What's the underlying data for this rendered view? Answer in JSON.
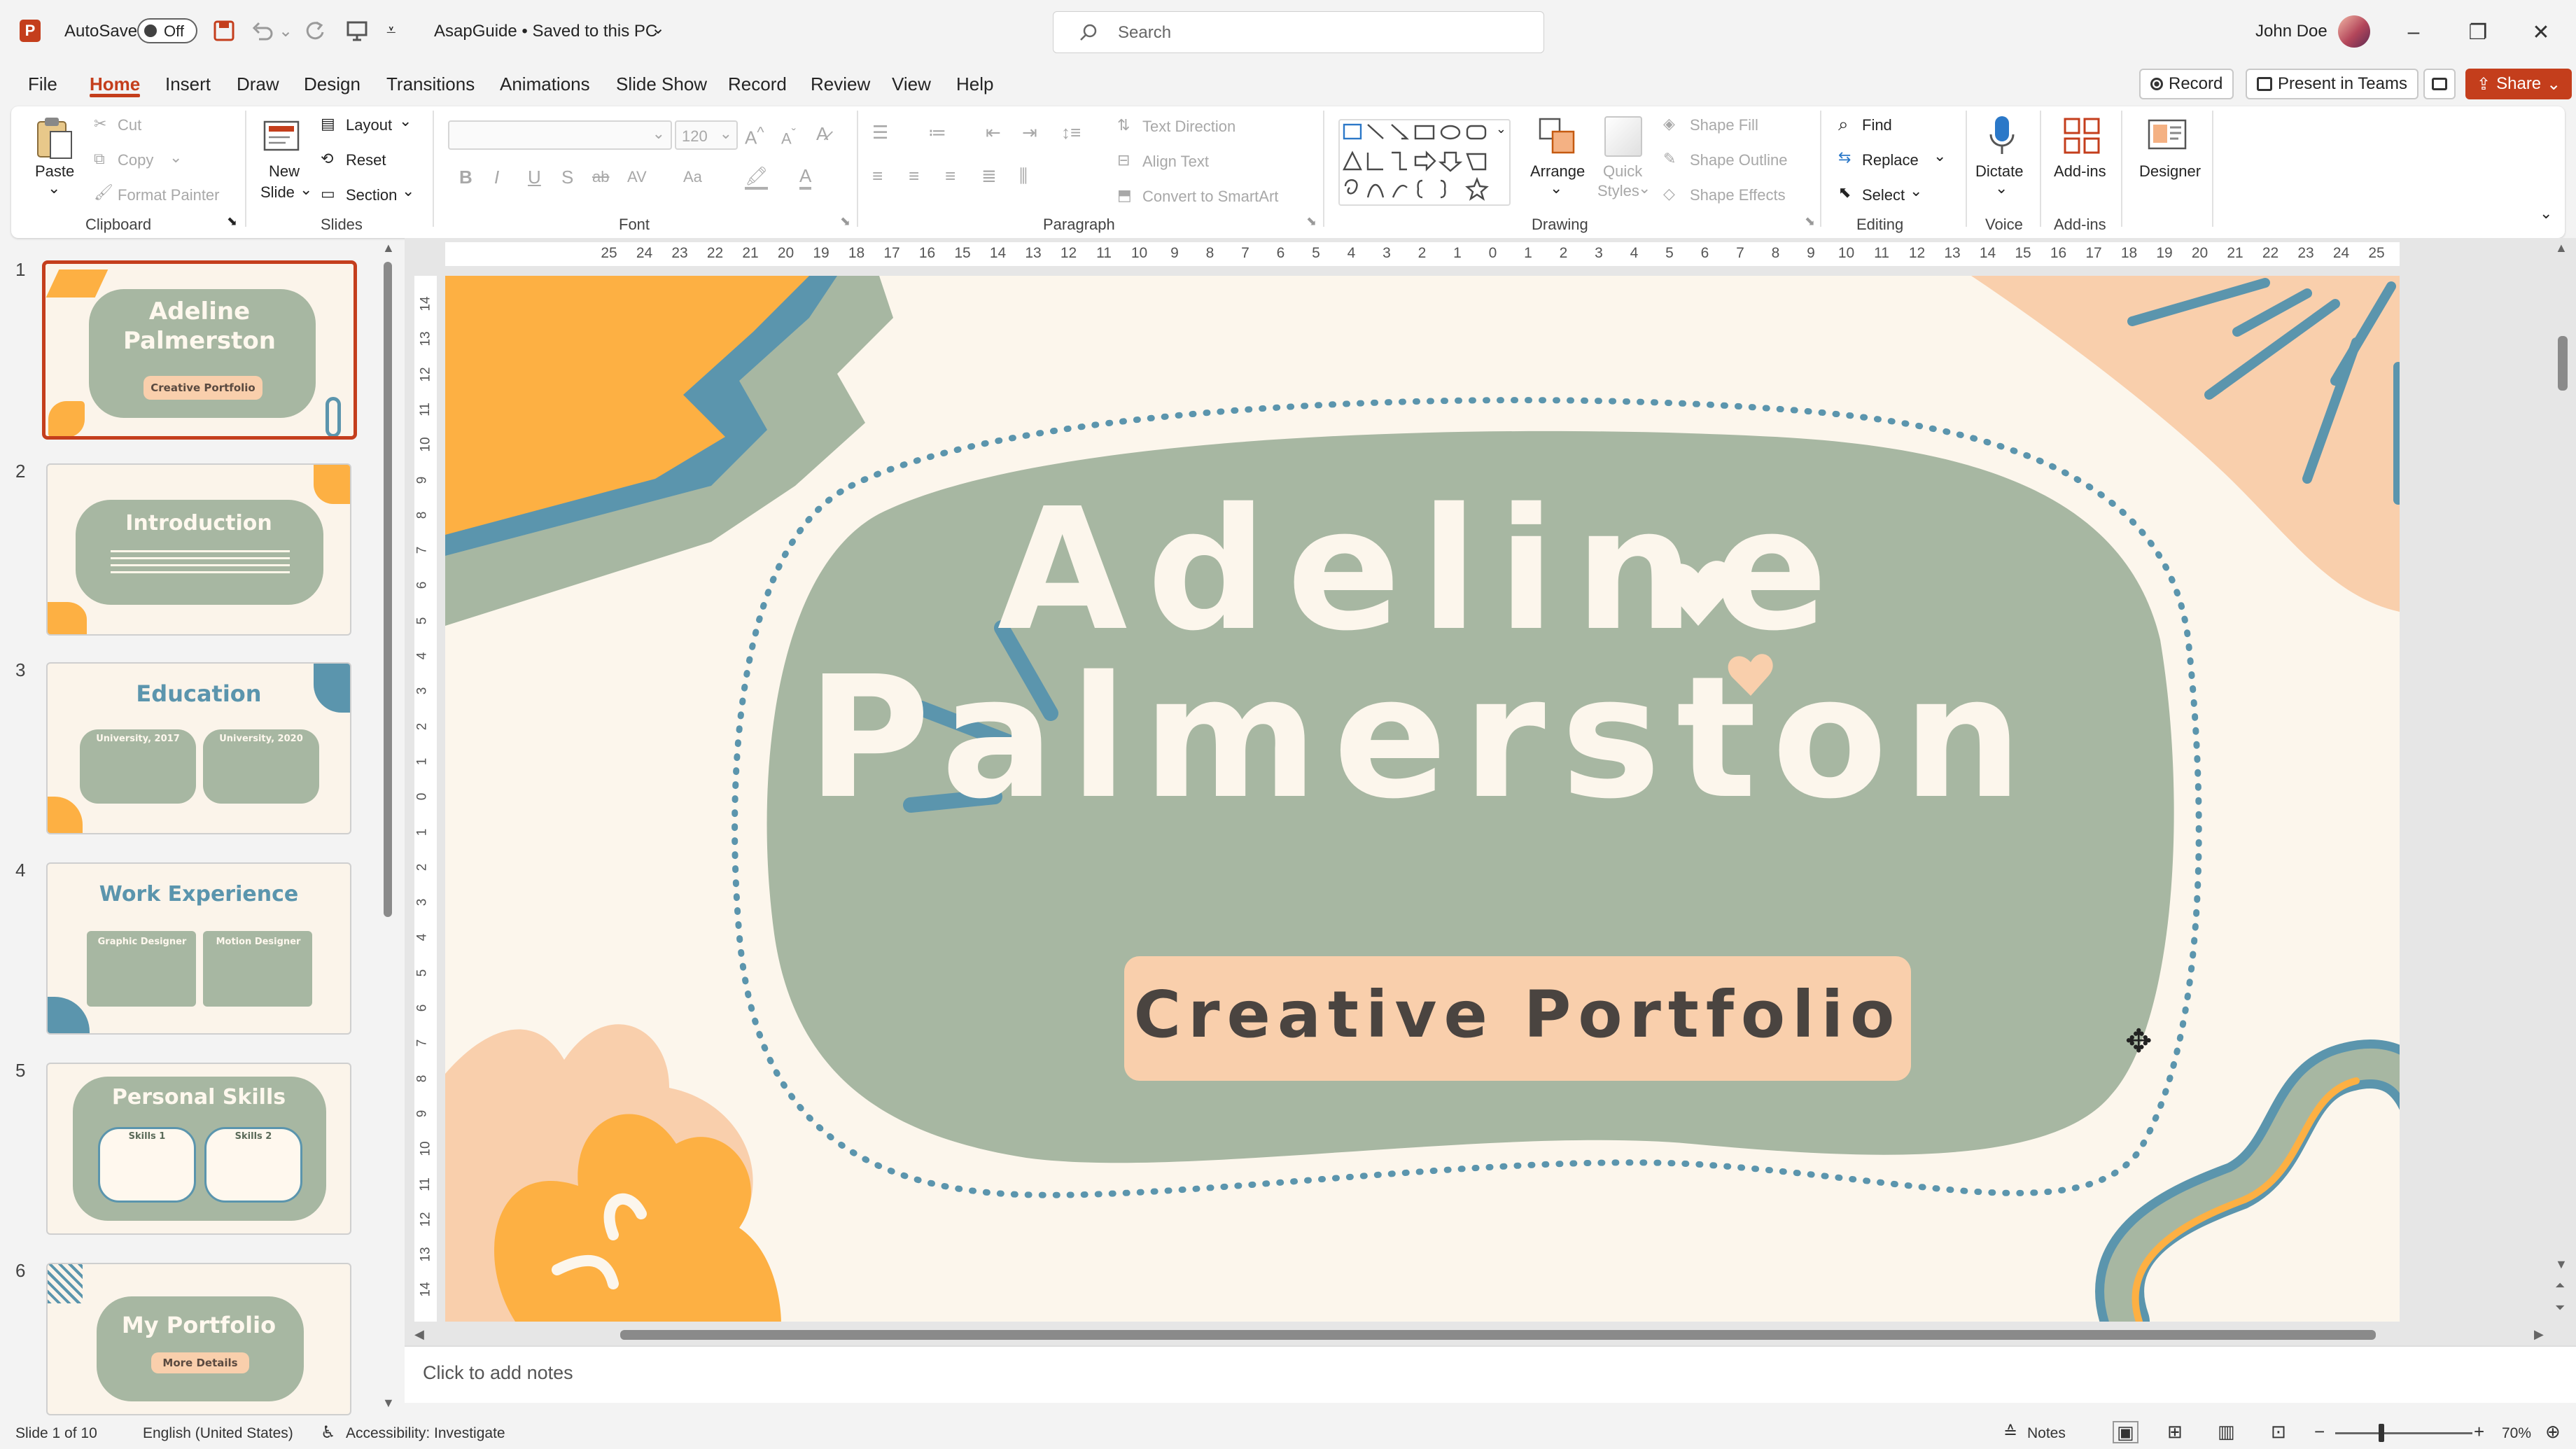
{
  "titlebar": {
    "autosave_label": "AutoSave",
    "autosave_state": "Off",
    "doc_title": "AsapGuide • Saved to this PC",
    "search_placeholder": "Search",
    "user_name": "John Doe"
  },
  "menu": {
    "tabs": [
      "File",
      "Home",
      "Insert",
      "Draw",
      "Design",
      "Transitions",
      "Animations",
      "Slide Show",
      "Record",
      "Review",
      "View",
      "Help"
    ],
    "record_btn": "Record",
    "present_btn": "Present in Teams",
    "share_btn": "Share"
  },
  "ribbon": {
    "clipboard": {
      "paste": "Paste",
      "cut": "Cut",
      "copy": "Copy",
      "format_painter": "Format Painter",
      "group": "Clipboard"
    },
    "slides": {
      "new_slide_1": "New",
      "new_slide_2": "Slide",
      "layout": "Layout",
      "reset": "Reset",
      "section": "Section",
      "group": "Slides"
    },
    "font": {
      "size": "120",
      "bold": "B",
      "italic": "I",
      "underline": "U",
      "shadow": "S",
      "strike": "ab",
      "spacing": "AV",
      "case": "Aa",
      "group": "Font"
    },
    "paragraph": {
      "text_direction": "Text Direction",
      "align_text": "Align Text",
      "convert_smartart": "Convert to SmartArt",
      "group": "Paragraph"
    },
    "drawing": {
      "arrange": "Arrange",
      "quick_styles_1": "Quick",
      "quick_styles_2": "Styles",
      "shape_fill": "Shape Fill",
      "shape_outline": "Shape Outline",
      "shape_effects": "Shape Effects",
      "group": "Drawing"
    },
    "editing": {
      "find": "Find",
      "replace": "Replace",
      "select": "Select",
      "group": "Editing"
    },
    "voice": {
      "dictate": "Dictate",
      "group": "Voice"
    },
    "addins": {
      "addins": "Add-ins",
      "group": "Add-ins"
    },
    "designer": {
      "label": "Designer"
    }
  },
  "ruler": {
    "horizontal": [
      "25",
      "24",
      "23",
      "22",
      "21",
      "20",
      "19",
      "18",
      "17",
      "16",
      "15",
      "14",
      "13",
      "12",
      "11",
      "10",
      "9",
      "8",
      "7",
      "6",
      "5",
      "4",
      "3",
      "2",
      "1",
      "0",
      "1",
      "2",
      "3",
      "4",
      "5",
      "6",
      "7",
      "8",
      "9",
      "10",
      "11",
      "12",
      "13",
      "14",
      "15",
      "16",
      "17",
      "18",
      "19",
      "20",
      "21",
      "22",
      "23",
      "24",
      "25"
    ],
    "vertical": [
      "14",
      "13",
      "12",
      "11",
      "10",
      "9",
      "8",
      "7",
      "6",
      "5",
      "4",
      "3",
      "2",
      "1",
      "0",
      "1",
      "2",
      "3",
      "4",
      "5",
      "6",
      "7",
      "8",
      "9",
      "10",
      "11",
      "12",
      "13",
      "14"
    ]
  },
  "thumbnails": [
    {
      "num": "1",
      "title_1": "Adeline",
      "title_2": "Palmerston",
      "pill": "Creative Portfolio"
    },
    {
      "num": "2",
      "title_1": "Introduction"
    },
    {
      "num": "3",
      "title_1": "Education",
      "col_1": "University, 2017",
      "col_2": "University, 2020"
    },
    {
      "num": "4",
      "title_1": "Work Experience",
      "col_1": "Graphic Designer",
      "col_2": "Motion Designer"
    },
    {
      "num": "5",
      "title_1": "Personal Skills",
      "col_1": "Skills 1",
      "col_2": "Skills 2"
    },
    {
      "num": "6",
      "title_1": "My Portfolio",
      "pill": "More Details"
    }
  ],
  "slide": {
    "title_line1": "Adeline",
    "title_line2": "Palmerston",
    "subtitle": "Creative Portfolio"
  },
  "notes": {
    "placeholder": "Click to add notes"
  },
  "status": {
    "slide_counter": "Slide 1 of 10",
    "language": "English (United States)",
    "accessibility": "Accessibility: Investigate",
    "notes_btn": "Notes",
    "zoom": "70%"
  },
  "colors": {
    "accent": "#c43e1c",
    "sage": "#a7b7a2",
    "cream": "#fcf6ec",
    "orange": "#fdb043",
    "peach": "#f9cfac",
    "teal": "#5b95ad"
  }
}
